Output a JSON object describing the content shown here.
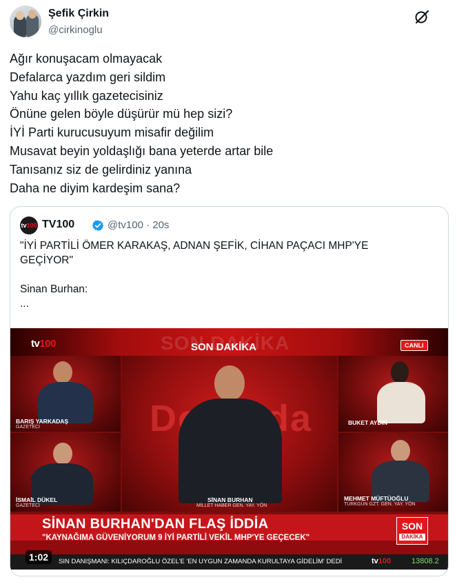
{
  "author": {
    "name": "Şefik Çirkin",
    "handle": "@cirkinoglu"
  },
  "tweet_lines": [
    "Ağır konuşacam olmayacak",
    "Defalarca yazdım geri sildim",
    "Yahu kaç yıllık gazetecisiniz",
    "Önüne gelen böyle düşürür mü hep sizi?",
    "İYİ Parti kurucusuyum misafir değilim",
    "Musavat beyin yoldaşlığı bana yeterde artar bile",
    "Tanısanız siz de gelirdiniz yanına",
    "Daha ne diyim kardeşim sana?"
  ],
  "quote": {
    "logo_text": "tv100",
    "name": "TV100",
    "handle_time": "@tv100 · 20s",
    "line1": "\"İYİ PARTİLİ ÖMER KARAKAŞ, ADNAN ŞEFİK, CİHAN PAÇACI MHP'YE",
    "line2": "GEÇİYOR\"",
    "line3": "Sinan Burhan:",
    "line4": "..."
  },
  "video": {
    "channel_logo": "tv100",
    "ghost_text": "SON DAKİKA",
    "son_dakika": "SON DAKİKA",
    "canli": "CANLI",
    "backdrop_word": "Doğruda",
    "guests": [
      {
        "name": "BARIŞ YARKADAŞ",
        "role": "GAZETECİ"
      },
      {
        "name": "İSMAİL DÜKEL",
        "role": "GAZETECİ"
      },
      {
        "name": "SİNAN BURHAN",
        "role": "MİLLET HABER GEN. YAY. YÖN"
      },
      {
        "name": "BUKET AYDIN",
        "role": ""
      },
      {
        "name": "MEHMET MÜFTÜOĞLU",
        "role": "TÜRKGÜN GZT. GEN. YAY. YÖN"
      }
    ],
    "headline": "SİNAN BURHAN'DAN FLAŞ İDDİA",
    "subheadline": "\"KAYNAĞIMA GÜVENİYORUM 9 İYİ PARTİLİ VEKİL MHP'YE GEÇECEK\"",
    "badge_top": "SON",
    "badge_bottom": "DAKİKA",
    "ticker": "SIN DANIŞMANI: KILIÇDAROĞLU ÖZEL'E 'EN UYGUN ZAMANDA KURULTAYA GİDELİM' DEDİ",
    "ticker_logo": "tv100",
    "ticker_number": "13808.2",
    "duration": "1:02"
  }
}
